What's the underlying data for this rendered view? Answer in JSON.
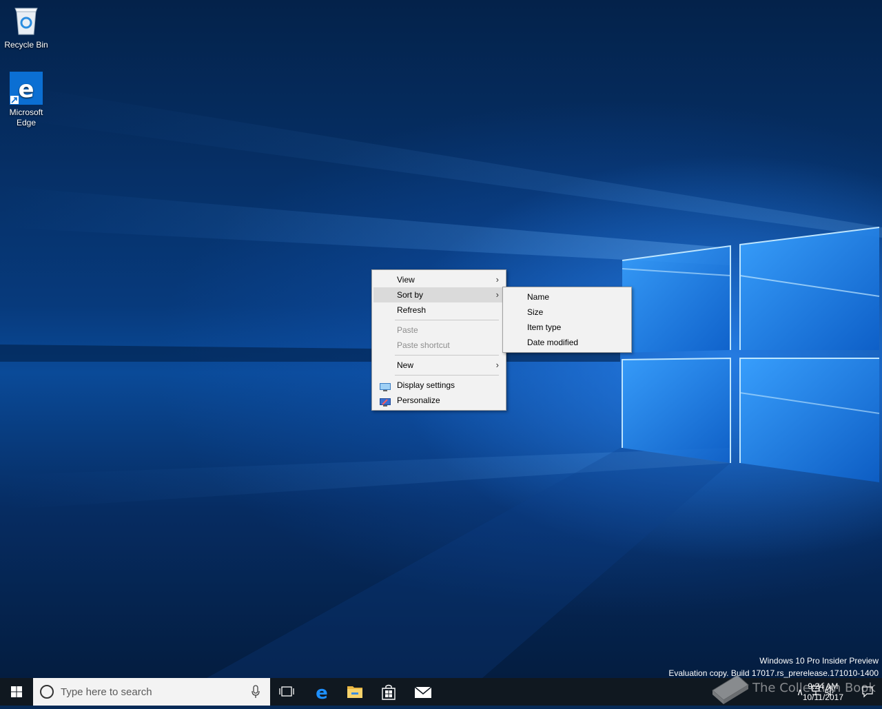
{
  "desktop": {
    "icons": [
      {
        "label": "Recycle Bin"
      },
      {
        "label": "Microsoft\nEdge",
        "line1": "Microsoft",
        "line2": "Edge"
      }
    ]
  },
  "context_menu": {
    "items": {
      "view": "View",
      "sort_by": "Sort by",
      "refresh": "Refresh",
      "paste": "Paste",
      "paste_shortcut": "Paste shortcut",
      "new": "New",
      "display_settings": "Display settings",
      "personalize": "Personalize"
    },
    "highlighted": "Sort by"
  },
  "sortby_submenu": {
    "items": [
      "Name",
      "Size",
      "Item type",
      "Date modified"
    ]
  },
  "watermark": {
    "line1": "Windows 10 Pro Insider Preview",
    "line2": "Evaluation copy. Build 17017.rs_prerelease.171010-1400"
  },
  "taskbar": {
    "search_placeholder": "Type here to search",
    "clock_time": "9:24 AM",
    "clock_date": "10/11/2017"
  },
  "overlay_watermark": "The Collection Book",
  "colors": {
    "taskbar": "#101820",
    "menu_bg": "#f2f2f2",
    "menu_highlight": "#dadada",
    "accent": "#0078d7"
  }
}
